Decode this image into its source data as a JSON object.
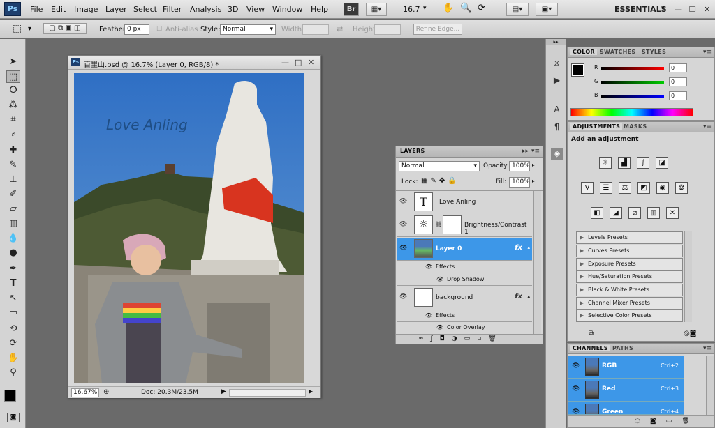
{
  "app": {
    "logo": "Ps"
  },
  "menu": [
    "File",
    "Edit",
    "Image",
    "Layer",
    "Select",
    "Filter",
    "Analysis",
    "3D",
    "View",
    "Window",
    "Help"
  ],
  "toolbar_top": {
    "bridge": "Br",
    "zoom": "16.7",
    "workspace": "ESSENTIALS"
  },
  "options": {
    "feather_label": "Feather:",
    "feather_value": "0 px",
    "antialias_label": "Anti-alias",
    "style_label": "Style:",
    "style_value": "Normal",
    "width_label": "Width:",
    "height_label": "Height:",
    "refine_label": "Refine Edge..."
  },
  "document": {
    "title": "百里山.psd @ 16.7% (Layer 0, RGB/8) *",
    "overlay_text": "Love Anling",
    "zoom": "16.67%",
    "doc_info": "Doc: 20.3M/23.5M"
  },
  "color_panel": {
    "tabs": [
      "COLOR",
      "SWATCHES",
      "STYLES"
    ],
    "channels": [
      {
        "label": "R",
        "value": "0"
      },
      {
        "label": "G",
        "value": "0"
      },
      {
        "label": "B",
        "value": "0"
      }
    ]
  },
  "adjustments_panel": {
    "tabs": [
      "ADJUSTMENTS",
      "MASKS"
    ],
    "heading": "Add an adjustment",
    "presets": [
      "Levels Presets",
      "Curves Presets",
      "Exposure Presets",
      "Hue/Saturation Presets",
      "Black & White Presets",
      "Channel Mixer Presets",
      "Selective Color Presets"
    ]
  },
  "layers_panel": {
    "tab": "LAYERS",
    "blend_mode": "Normal",
    "opacity_label": "Opacity:",
    "opacity_value": "100%",
    "lock_label": "Lock:",
    "fill_label": "Fill:",
    "fill_value": "100%",
    "layers": [
      {
        "name": "Love Anling",
        "thumb": "T"
      },
      {
        "name": "Brightness/Contrast 1",
        "thumb": "☼"
      },
      {
        "name": "Layer 0",
        "effects": "Effects",
        "effect_item": "Drop Shadow"
      },
      {
        "name": "background",
        "effects": "Effects",
        "effect_item": "Color Overlay"
      }
    ],
    "fx": "fx"
  },
  "channels_panel": {
    "tabs": [
      "CHANNELS",
      "PATHS"
    ],
    "rows": [
      {
        "name": "RGB",
        "shortcut": "Ctrl+2"
      },
      {
        "name": "Red",
        "shortcut": "Ctrl+3"
      },
      {
        "name": "Green",
        "shortcut": "Ctrl+4"
      }
    ]
  },
  "colors": {
    "selection_blue": "#3d97e8",
    "ps_blue": "#1e3f6e"
  }
}
